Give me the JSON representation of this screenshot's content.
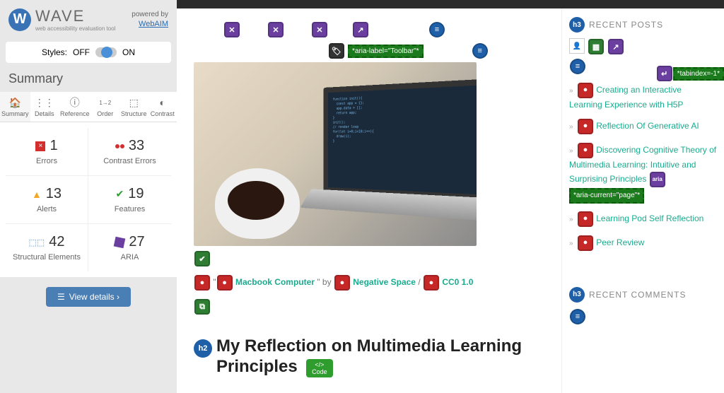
{
  "brand": {
    "name": "WAVE",
    "tagline": "web accessibility evaluation tool",
    "powered_label": "powered by",
    "powered_by": "WebAIM"
  },
  "styles_row": {
    "label": "Styles:",
    "off": "OFF",
    "on": "ON"
  },
  "summary_title": "Summary",
  "tabs": [
    {
      "label": "Summary",
      "icon": "🏠"
    },
    {
      "label": "Details",
      "icon": "⋮⋮"
    },
    {
      "label": "Reference",
      "icon": "ⓘ"
    },
    {
      "label": "Order",
      "icon": "1→2"
    },
    {
      "label": "Structure",
      "icon": "⬚"
    },
    {
      "label": "Contrast",
      "icon": "◐"
    }
  ],
  "stats": {
    "errors": {
      "count": "1",
      "label": "Errors"
    },
    "contrast": {
      "count": "33",
      "label": "Contrast Errors"
    },
    "alerts": {
      "count": "13",
      "label": "Alerts"
    },
    "features": {
      "count": "19",
      "label": "Features"
    },
    "structural": {
      "count": "42",
      "label": "Structural Elements"
    },
    "aria": {
      "count": "27",
      "label": "ARIA"
    }
  },
  "details_button": "View details ›",
  "overlay": {
    "aria_toolbar": "*aria-label=\"Toolbar\"*",
    "aria_current": "*aria-current=\"page\"*",
    "tabindex": "*tabindex=-1*",
    "aria_badge": "aria"
  },
  "caption": {
    "title": "Macbook Computer",
    "by": "\" by ",
    "author": "Negative Space",
    "slash": "/ ",
    "license": "CC0 1.0"
  },
  "h2": {
    "badge": "h2",
    "text": "My Reflection on Multimedia Learning Principles",
    "code": "Code",
    "code_icon": "</>"
  },
  "right": {
    "recent_posts": {
      "badge": "h3",
      "label": "RECENT POSTS"
    },
    "posts": [
      "Creating an Interactive Learning Experience with H5P",
      "Reflection Of Generative AI",
      "Discovering Cognitive Theory of Multimedia Learning: Intuitive and Surprising Principles",
      "Learning Pod Self Reflection",
      "Peer Review"
    ],
    "recent_comments": {
      "badge": "h3",
      "label": "RECENT COMMENTS"
    }
  }
}
